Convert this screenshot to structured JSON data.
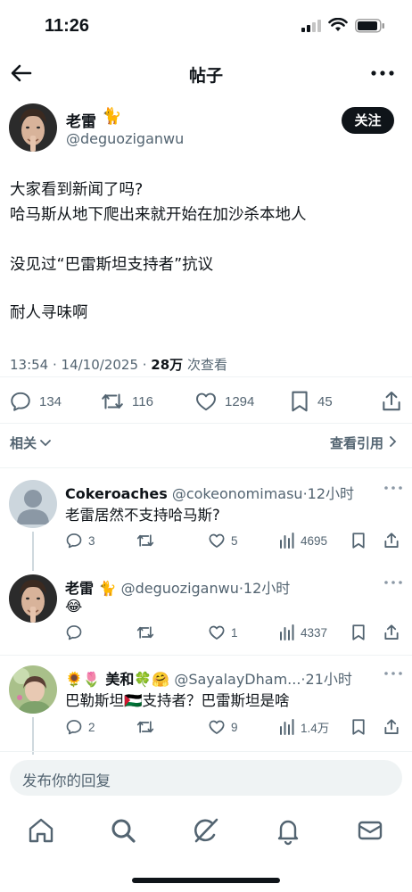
{
  "status_bar": {
    "time": "11:26"
  },
  "header": {
    "title": "帖子"
  },
  "post": {
    "author_name": "老雷",
    "author_emoji": "🐈",
    "handle": "@deguoziganwu",
    "follow_label": "关注",
    "lines": [
      "大家看到新闻了吗?",
      "哈马斯从地下爬出来就开始在加沙杀本地人",
      "没见过“巴雷斯坦支持者”抗议",
      "耐人寻味啊"
    ],
    "timestamp": "13:54 · 14/10/2025 · ",
    "views_count": "28万",
    "views_label": " 次查看",
    "stats": {
      "replies": "134",
      "reposts": "116",
      "likes": "1294",
      "bookmarks": "45"
    }
  },
  "nav": {
    "related_label": "相关",
    "quotes_label": "查看引用"
  },
  "replies": [
    {
      "name": "Cokeroaches",
      "handle": " @cokeonomimasu",
      "time": "·12小时",
      "text": "老雷居然不支持哈马斯?",
      "replies": "3",
      "reposts": "",
      "likes": "5",
      "views": "4695"
    },
    {
      "name": "老雷 🐈",
      "handle": " @deguoziganwu",
      "time": "·12小时",
      "text": "😂",
      "replies": "",
      "reposts": "",
      "likes": "1",
      "views": "4337"
    },
    {
      "name": "🌻🌷 美和🍀🤗",
      "handle": " @SayalayDham...",
      "time": "·21小时",
      "text": "巴勒斯坦🇵🇸支持者？巴雷斯坦是啥",
      "replies": "2",
      "reposts": "",
      "likes": "9",
      "views": "1.4万"
    }
  ],
  "composer": {
    "placeholder": "发布你的回复"
  },
  "colors": {
    "text": "#0f1419",
    "muted": "#536471",
    "divider": "#eff3f4",
    "thread_line": "#cfd9de"
  }
}
